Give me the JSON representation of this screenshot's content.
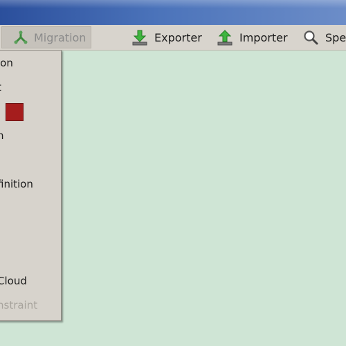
{
  "toolbar": {
    "migration_label": "Migration",
    "exporter_label": "Exporter",
    "importer_label": "Importer",
    "search_label": "Spel"
  },
  "menu": {
    "items": [
      {
        "label": "ion"
      },
      {
        "label": "t"
      },
      {
        "label": "n"
      },
      {
        "label": "finition"
      },
      {
        "label": "Cloud"
      },
      {
        "label": "nstraint",
        "disabled": true
      }
    ],
    "swatch_color": "#a51d1d"
  },
  "colors": {
    "canvas": "#cfe5d5",
    "titlebar": "#4b73ba",
    "toolbar": "#d8d4cd"
  }
}
